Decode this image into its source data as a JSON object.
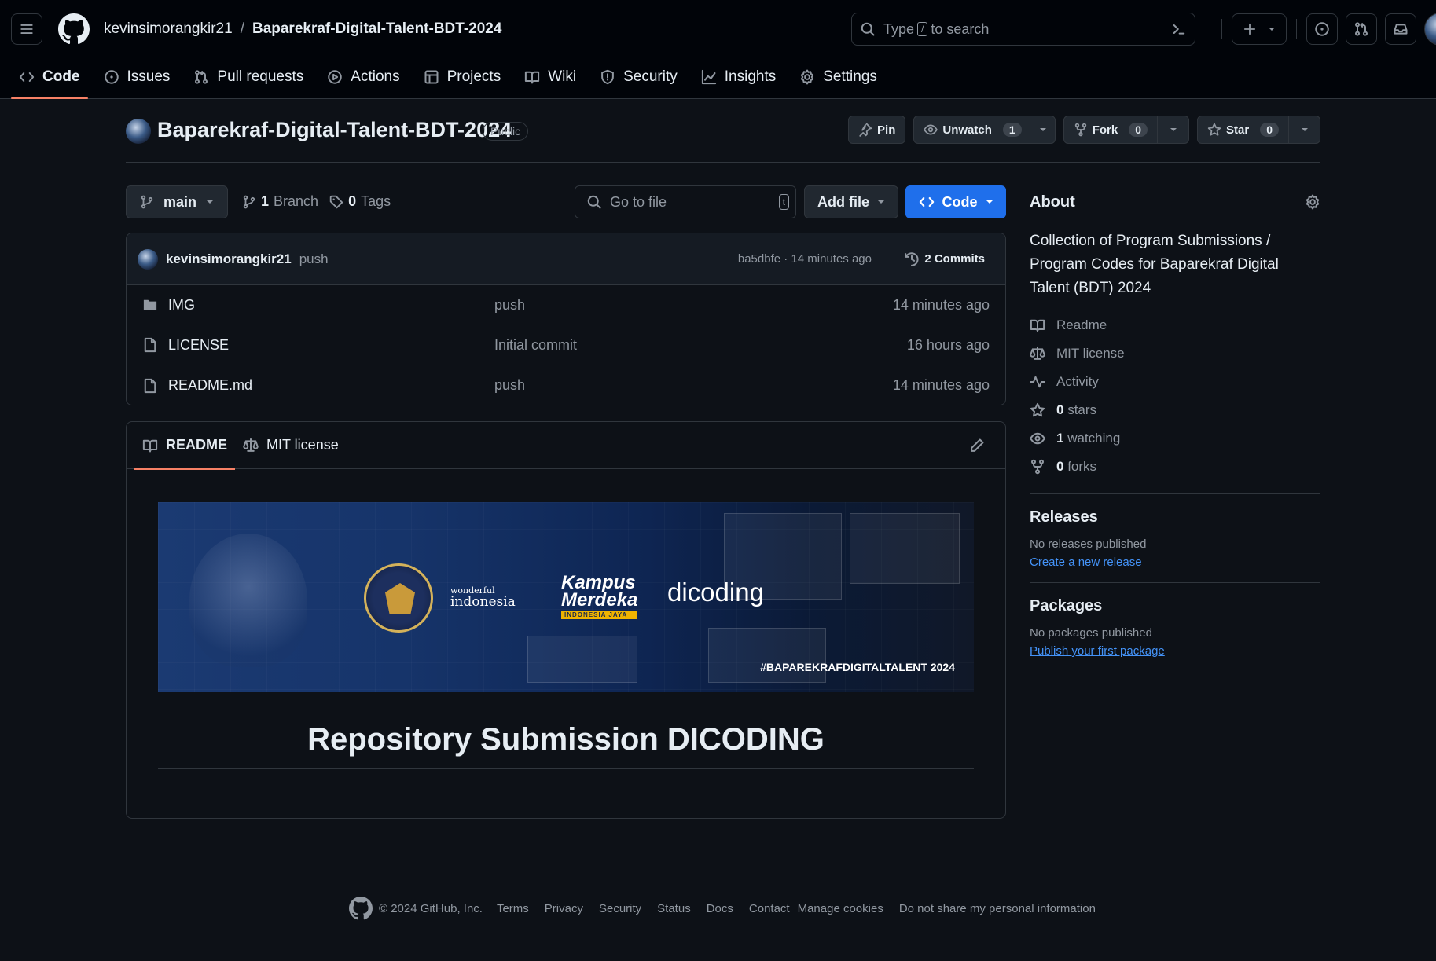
{
  "header": {
    "owner": "kevinsimorangkir21",
    "separator": "/",
    "repo": "Baparekraf-Digital-Talent-BDT-2024",
    "search_prefix": "Type",
    "search_key": "/",
    "search_suffix": "to search"
  },
  "nav_tabs": [
    {
      "label": "Code",
      "icon": "code-icon"
    },
    {
      "label": "Issues",
      "icon": "issue-icon"
    },
    {
      "label": "Pull requests",
      "icon": "pull-request-icon"
    },
    {
      "label": "Actions",
      "icon": "play-icon"
    },
    {
      "label": "Projects",
      "icon": "table-icon"
    },
    {
      "label": "Wiki",
      "icon": "book-icon"
    },
    {
      "label": "Security",
      "icon": "shield-icon"
    },
    {
      "label": "Insights",
      "icon": "graph-icon"
    },
    {
      "label": "Settings",
      "icon": "gear-icon"
    }
  ],
  "repo_head": {
    "title": "Baparekraf-Digital-Talent-BDT-2024",
    "visibility": "Public",
    "pin_label": "Pin",
    "watch_label": "Unwatch",
    "watch_count": "1",
    "fork_label": "Fork",
    "fork_count": "0",
    "star_label": "Star",
    "star_count": "0"
  },
  "toolbar": {
    "branch": "main",
    "branch_count": "1",
    "branch_label": "Branch",
    "tag_count": "0",
    "tag_label": "Tags",
    "goto_placeholder": "Go to file",
    "goto_key": "t",
    "add_file": "Add file",
    "code": "Code"
  },
  "latest_commit": {
    "author": "kevinsimorangkir21",
    "message": "push",
    "meta": "ba5dbfe · 14 minutes ago",
    "commits": "2 Commits"
  },
  "files": [
    {
      "name": "IMG",
      "type": "folder",
      "message": "push",
      "age": "14 minutes ago"
    },
    {
      "name": "LICENSE",
      "type": "file",
      "message": "Initial commit",
      "age": "16 hours ago"
    },
    {
      "name": "README.md",
      "type": "file",
      "message": "push",
      "age": "14 minutes ago"
    }
  ],
  "readme": {
    "tab_readme": "README",
    "tab_license": "MIT license",
    "banner": {
      "wonderful": "wonderful",
      "indonesia": "indonesia",
      "kampus": "Kampus",
      "merdeka": "Merdeka",
      "indonesia_jaya": "INDONESIA JAYA",
      "dicoding": "dicoding",
      "hashtag": "#BAPAREKRAFDIGITALTALENT 2024"
    },
    "heading": "Repository Submission DICODING"
  },
  "sidebar": {
    "about_title": "About",
    "description": "Collection of Program Submissions / Program Codes for Baparekraf Digital Talent (BDT) 2024",
    "links": [
      {
        "icon": "book-icon",
        "count": "",
        "label": "Readme"
      },
      {
        "icon": "law-icon",
        "count": "",
        "label": "MIT license"
      },
      {
        "icon": "pulse-icon",
        "count": "",
        "label": "Activity"
      },
      {
        "icon": "star-icon",
        "count": "0",
        "label": "stars"
      },
      {
        "icon": "eye-icon",
        "count": "1",
        "label": "watching"
      },
      {
        "icon": "fork-icon",
        "count": "0",
        "label": "forks"
      }
    ],
    "releases_title": "Releases",
    "releases_text": "No releases published",
    "releases_link": "Create a new release",
    "packages_title": "Packages",
    "packages_text": "No packages published",
    "packages_link": "Publish your first package"
  },
  "footer": {
    "copyright": "© 2024 GitHub, Inc.",
    "links": [
      "Terms",
      "Privacy",
      "Security",
      "Status",
      "Docs",
      "Contact",
      "Manage cookies",
      "Do not share my personal information"
    ]
  },
  "colors": {
    "background": "#0d1117",
    "header": "#010409",
    "border": "#30363d",
    "accent_underline": "#f78166",
    "primary_button": "#1f6feb",
    "link": "#4493f8"
  }
}
